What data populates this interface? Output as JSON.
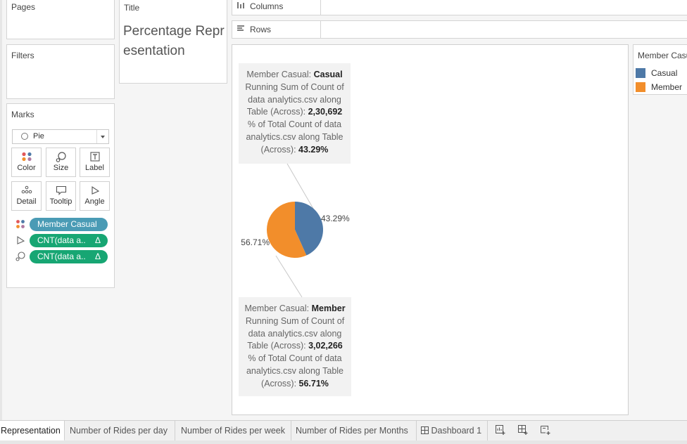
{
  "cards": {
    "pages_label": "Pages",
    "filters_label": "Filters",
    "marks_label": "Marks",
    "title_label": "Title"
  },
  "title_text": "Percentage Representation",
  "marks": {
    "mark_type": "Pie",
    "buttons": {
      "color": "Color",
      "size": "Size",
      "label": "Label",
      "detail": "Detail",
      "tooltip": "Tooltip",
      "angle": "Angle"
    },
    "pills": [
      {
        "label": "Member Casual",
        "delta": "",
        "icon": "color-dots-icon"
      },
      {
        "label": "CNT(data a..",
        "delta": "Δ",
        "icon": "angle-icon"
      },
      {
        "label": "CNT(data a..",
        "delta": "Δ",
        "icon": "size-icon"
      }
    ]
  },
  "shelves": {
    "columns": "Columns",
    "rows": "Rows"
  },
  "chart_data": {
    "type": "pie",
    "categories": [
      "Casual",
      "Member"
    ],
    "values": [
      43.29,
      56.71
    ],
    "data_labels": [
      "43.29%",
      "56.71%"
    ],
    "colors": [
      "#4e79a7",
      "#f28e2b"
    ],
    "legend_title": "Member Casual",
    "legend_position": "right"
  },
  "tooltips": {
    "casual": {
      "l1a": "Member Casual: ",
      "l1b": "Casual",
      "l2": "Running Sum of Count of",
      "l3": "data analytics.csv along",
      "l4a": "Table (Across): ",
      "l4b": "2,30,692",
      "l5": "% of Total Count of data",
      "l6": "analytics.csv along Table",
      "l7a": "(Across): ",
      "l7b": "43.29%"
    },
    "member": {
      "l1a": "Member Casual: ",
      "l1b": "Member",
      "l2": "Running Sum of Count of",
      "l3": "data analytics.csv along",
      "l4a": "Table (Across): ",
      "l4b": "3,02,266",
      "l5": "% of Total Count of data",
      "l6": "analytics.csv along Table",
      "l7a": "(Across): ",
      "l7b": "56.71%"
    }
  },
  "legend": {
    "title": "Member Casual",
    "items": [
      {
        "label": "Casual",
        "color": "#4e79a7"
      },
      {
        "label": "Member",
        "color": "#f28e2b"
      }
    ]
  },
  "tabs": [
    {
      "label": "Representation",
      "active": true
    },
    {
      "label": "Number of Rides per day",
      "active": false
    },
    {
      "label": "Number of Rides per week",
      "active": false
    },
    {
      "label": "Number of Rides per Months",
      "active": false
    },
    {
      "label": "Dashboard 1",
      "active": false
    }
  ]
}
